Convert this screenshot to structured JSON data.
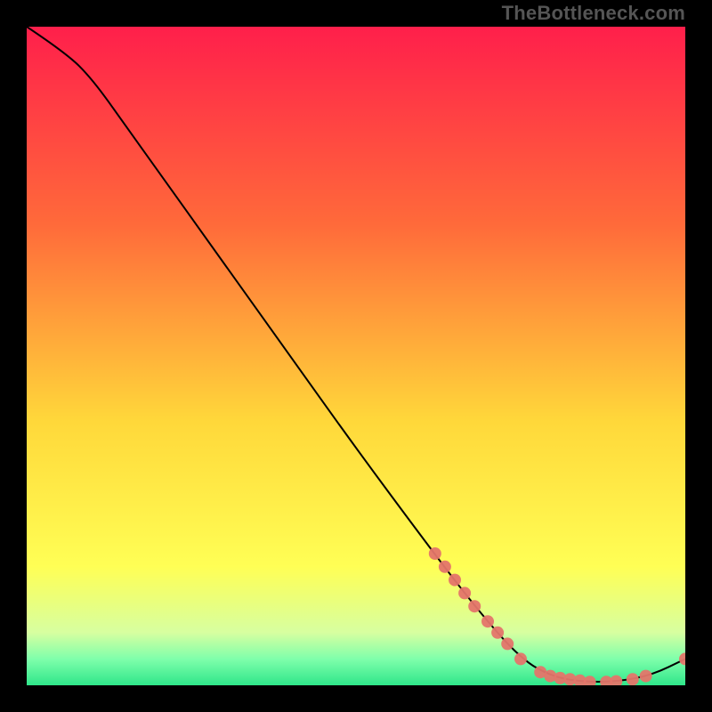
{
  "attribution": "TheBottleneck.com",
  "chart_data": {
    "type": "line",
    "title": "",
    "xlabel": "",
    "ylabel": "",
    "xlim": [
      0,
      100
    ],
    "ylim": [
      0,
      100
    ],
    "curve": [
      {
        "x": 0,
        "y": 100
      },
      {
        "x": 6,
        "y": 96
      },
      {
        "x": 10,
        "y": 92
      },
      {
        "x": 15,
        "y": 85
      },
      {
        "x": 20,
        "y": 78
      },
      {
        "x": 30,
        "y": 64
      },
      {
        "x": 40,
        "y": 50
      },
      {
        "x": 50,
        "y": 36
      },
      {
        "x": 60,
        "y": 22.5
      },
      {
        "x": 68,
        "y": 12
      },
      {
        "x": 75,
        "y": 4
      },
      {
        "x": 80,
        "y": 1.2
      },
      {
        "x": 85,
        "y": 0.5
      },
      {
        "x": 90,
        "y": 0.6
      },
      {
        "x": 95,
        "y": 1.6
      },
      {
        "x": 100,
        "y": 4
      }
    ],
    "highlight_points": [
      {
        "x": 62,
        "y": 20
      },
      {
        "x": 63.5,
        "y": 18
      },
      {
        "x": 65,
        "y": 16
      },
      {
        "x": 66.5,
        "y": 14
      },
      {
        "x": 68,
        "y": 12
      },
      {
        "x": 70,
        "y": 9.7
      },
      {
        "x": 71.5,
        "y": 8
      },
      {
        "x": 73,
        "y": 6.3
      },
      {
        "x": 75,
        "y": 4
      },
      {
        "x": 78,
        "y": 2
      },
      {
        "x": 79.5,
        "y": 1.4
      },
      {
        "x": 81,
        "y": 1.1
      },
      {
        "x": 82.5,
        "y": 0.9
      },
      {
        "x": 84,
        "y": 0.7
      },
      {
        "x": 85.5,
        "y": 0.5
      },
      {
        "x": 88,
        "y": 0.5
      },
      {
        "x": 89.5,
        "y": 0.6
      },
      {
        "x": 92,
        "y": 0.9
      },
      {
        "x": 94,
        "y": 1.4
      },
      {
        "x": 100,
        "y": 4
      }
    ],
    "background_gradient": {
      "top": "#ff1f4b",
      "mid1": "#ff6a3a",
      "mid2": "#ffd83a",
      "low": "#ffff55",
      "band": "#b8ff6e",
      "bottom": "#2fe68a"
    }
  }
}
